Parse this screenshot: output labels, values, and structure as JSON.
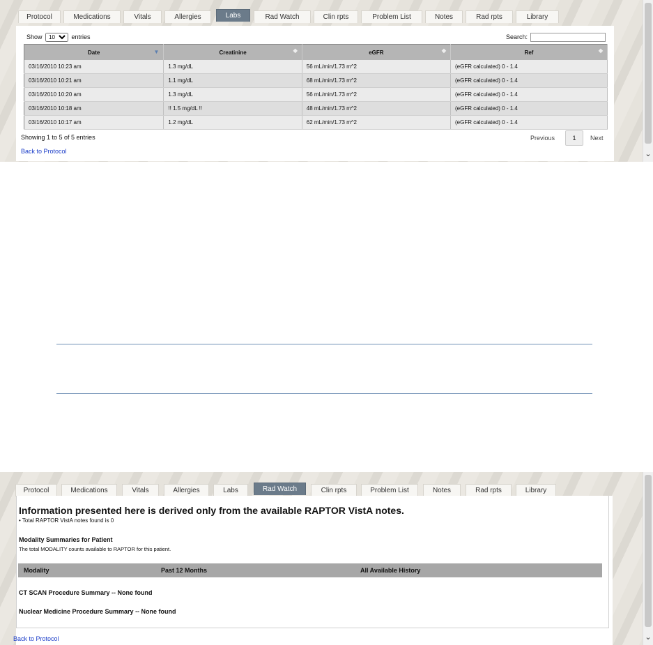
{
  "tabs": [
    "Protocol",
    "Medications",
    "Vitals",
    "Allergies",
    "Labs",
    "Rad Watch",
    "Clin rpts",
    "Problem List",
    "Notes",
    "Rad rpts",
    "Library"
  ],
  "labs": {
    "show_label": "Show",
    "show_value": "10",
    "entries_label": "entries",
    "search_label": "Search:",
    "columns": [
      "Date",
      "Creatinine",
      "eGFR",
      "Ref"
    ],
    "rows": [
      [
        "03/16/2010 10:23 am",
        "1.3 mg/dL",
        "56 mL/min/1.73 m^2",
        "(eGFR calculated)  0 - 1.4"
      ],
      [
        "03/16/2010 10:21 am",
        "1.1 mg/dL",
        "68 mL/min/1.73 m^2",
        "(eGFR calculated)  0 - 1.4"
      ],
      [
        "03/16/2010 10:20 am",
        "1.3 mg/dL",
        "56 mL/min/1.73 m^2",
        "(eGFR calculated)  0 - 1.4"
      ],
      [
        "03/16/2010 10:18 am",
        "!! 1.5 mg/dL !!",
        "48 mL/min/1.73 m^2",
        "(eGFR calculated)  0 - 1.4"
      ],
      [
        "03/16/2010 10:17 am",
        "1.2 mg/dL",
        "62 mL/min/1.73 m^2",
        "(eGFR calculated)  0 - 1.4"
      ]
    ],
    "info": "Showing 1 to 5 of 5 entries",
    "previous": "Previous",
    "page": "1",
    "next": "Next",
    "back": "Back to Protocol"
  },
  "rad": {
    "title": "Information presented here is derived only from the available RAPTOR VistA notes.",
    "total": "•  Total RAPTOR VistA notes found is 0",
    "modality_heading": "Modality Summaries for Patient",
    "modality_desc": "The total MODALITY counts available to RAPTOR for this patient.",
    "table_cols": [
      "Modality",
      "Past 12 Months",
      "All Available History"
    ],
    "ct_summary": "CT SCAN Procedure Summary -- None found",
    "nm_summary": "Nuclear Medicine Procedure Summary -- None found",
    "back": "Back to Protocol"
  },
  "scroll_arrow": "⌄"
}
